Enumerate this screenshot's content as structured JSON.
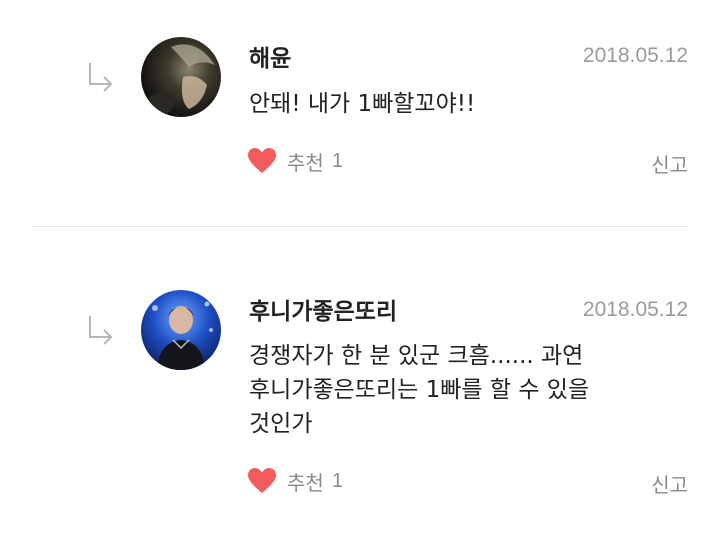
{
  "comments": [
    {
      "author": "해윤",
      "date": "2018.05.12",
      "text": "안돼! 내가 1빠할꼬야!!",
      "like_label": "추천",
      "like_count": "1",
      "report_label": "신고",
      "avatar_icon": "profile-photo-dark",
      "reply_icon": "reply-arrow-icon",
      "heart_color": "#f25c5c"
    },
    {
      "author": "후니가좋은또리",
      "date": "2018.05.12",
      "text_lines": [
        "경쟁자가 한 분 있군 크흠...... 과연",
        "후니가좋은또리는 1빠를 할 수 있을",
        "것인가"
      ],
      "like_label": "추천",
      "like_count": "1",
      "report_label": "신고",
      "avatar_icon": "profile-photo-blue-stage",
      "reply_icon": "reply-arrow-icon",
      "heart_color": "#f25c5c"
    }
  ]
}
